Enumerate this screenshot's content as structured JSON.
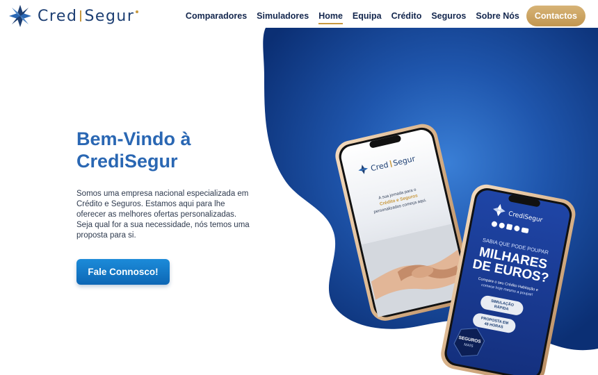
{
  "brand": {
    "name_part1": "Cred",
    "name_part2": "Segur",
    "logo_icon": "credisegur-star-icon",
    "colors": {
      "navy": "#1d3f73",
      "gold": "#c8993f",
      "blue": "#2a67b3"
    }
  },
  "nav": {
    "items": [
      {
        "label": "Comparadores",
        "active": false
      },
      {
        "label": "Simuladores",
        "active": false
      },
      {
        "label": "Home",
        "active": true
      },
      {
        "label": "Equipa",
        "active": false
      },
      {
        "label": "Crédito",
        "active": false
      },
      {
        "label": "Seguros",
        "active": false
      },
      {
        "label": "Sobre Nós",
        "active": false
      }
    ],
    "cta": "Contactos"
  },
  "hero": {
    "title_line1": "Bem-Vindo à",
    "title_line2": "CrediSegur",
    "text": "Somos uma empresa nacional especializada em Crédito e Seguros. Estamos aqui para lhe oferecer as melhores ofertas personalizadas. Seja qual for a sua necessidade, nós temos uma proposta para si.",
    "button": "Fale Connosco!"
  },
  "phone_left": {
    "brand_part1": "Cred",
    "brand_part2": "Segur",
    "line1": "A sua jornada para o",
    "line2": "Crédito e Seguros",
    "line3": "personalizados começa aqui."
  },
  "phone_right": {
    "brand": "CrediSegur",
    "social_icons": [
      "instagram-icon",
      "facebook-icon",
      "linkedin-icon",
      "instagram-icon",
      "youtube-icon"
    ],
    "kicker": "SABIA QUE PODE POUPAR",
    "headline1": "MILHARES",
    "headline2": "DE EUROS?",
    "subline1": "Compare o seu Crédito Habitação e",
    "subline2": "comece hoje mesmo a poupar!",
    "btn1_line1": "SIMULAÇÃO",
    "btn1_line2": "RÁPIDA",
    "btn2_line1": "PROPOSTA EM",
    "btn2_line2": "48 HORAS",
    "badge1": "SEGUROS",
    "badge2": "MAIS"
  }
}
